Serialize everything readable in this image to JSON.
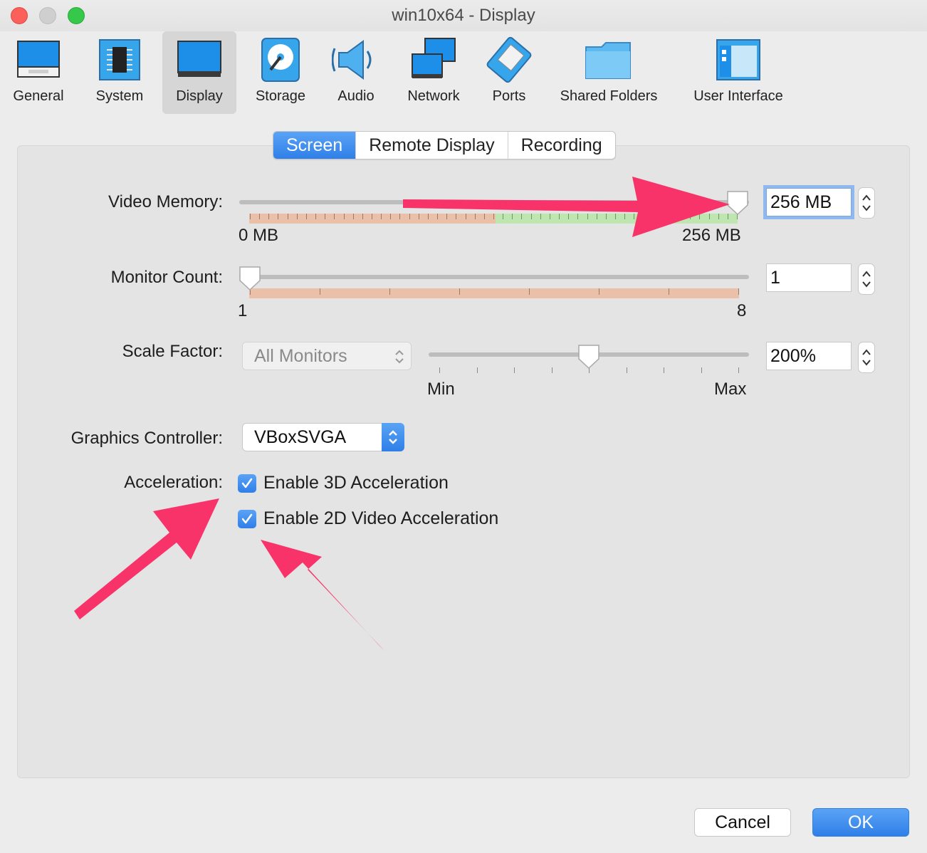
{
  "window": {
    "title": "win10x64 - Display"
  },
  "toolbar": {
    "items": [
      {
        "label": "General"
      },
      {
        "label": "System"
      },
      {
        "label": "Display"
      },
      {
        "label": "Storage"
      },
      {
        "label": "Audio"
      },
      {
        "label": "Network"
      },
      {
        "label": "Ports"
      },
      {
        "label": "Shared Folders"
      },
      {
        "label": "User Interface"
      }
    ],
    "selected": "Display"
  },
  "tabs": {
    "items": [
      {
        "label": "Screen"
      },
      {
        "label": "Remote Display"
      },
      {
        "label": "Recording"
      }
    ],
    "selected": "Screen"
  },
  "video_memory": {
    "label": "Video Memory:",
    "value": "256 MB",
    "min_label": "0 MB",
    "max_label": "256 MB",
    "slider_fraction": 1.0
  },
  "monitor_count": {
    "label": "Monitor Count:",
    "value": "1",
    "min_label": "1",
    "max_label": "8",
    "slider_fraction": 0.0
  },
  "scale_factor": {
    "label": "Scale Factor:",
    "scope": "All Monitors",
    "value": "200%",
    "min_label": "Min",
    "max_label": "Max",
    "slider_fraction": 0.5
  },
  "graphics_controller": {
    "label": "Graphics Controller:",
    "value": "VBoxSVGA"
  },
  "acceleration": {
    "label": "Acceleration:",
    "options": [
      {
        "label": "Enable 3D Acceleration",
        "checked": true
      },
      {
        "label": "Enable 2D Video Acceleration",
        "checked": true
      }
    ]
  },
  "buttons": {
    "cancel": "Cancel",
    "ok": "OK"
  },
  "colors": {
    "accent": "#2f7fe8",
    "annotation_arrow": "#f7336a"
  }
}
